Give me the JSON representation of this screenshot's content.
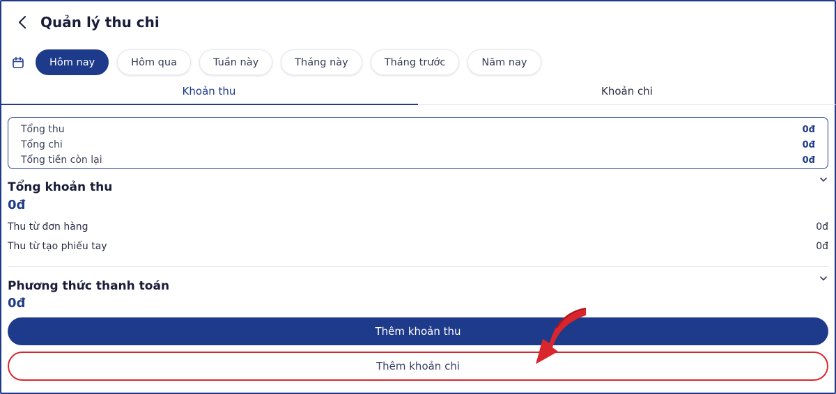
{
  "header": {
    "title": "Quản lý thu chi"
  },
  "filters": {
    "chips": [
      {
        "label": "Hôm nay",
        "active": true
      },
      {
        "label": "Hôm qua",
        "active": false
      },
      {
        "label": "Tuần này",
        "active": false
      },
      {
        "label": "Tháng này",
        "active": false
      },
      {
        "label": "Tháng trước",
        "active": false
      },
      {
        "label": "Năm nay",
        "active": false
      }
    ]
  },
  "tabs": [
    {
      "label": "Khoản thu",
      "active": true
    },
    {
      "label": "Khoản chi",
      "active": false
    }
  ],
  "summary": {
    "rows": [
      {
        "label": "Tổng thu",
        "value": "0đ"
      },
      {
        "label": "Tổng chi",
        "value": "0đ"
      },
      {
        "label": "Tổng tiền còn lại",
        "value": "0đ"
      }
    ]
  },
  "income_section": {
    "title": "Tổng khoản thu",
    "total": "0đ",
    "rows": [
      {
        "label": "Thu từ đơn hàng",
        "value": "0đ"
      },
      {
        "label": "Thu từ tạo phiếu tay",
        "value": "0đ"
      }
    ]
  },
  "payment_section": {
    "title": "Phương thức thanh toán",
    "total": "0đ"
  },
  "actions": {
    "add_income_label": "Thêm khoản thu",
    "add_expense_label": "Thêm khoản chi"
  },
  "colors": {
    "primary": "#1e3a8a",
    "highlight": "#d8262c"
  },
  "icons": {
    "back": "chevron-left-icon",
    "calendar": "calendar-icon",
    "expand": "chevron-down-icon",
    "annotation": "arrow-icon"
  }
}
